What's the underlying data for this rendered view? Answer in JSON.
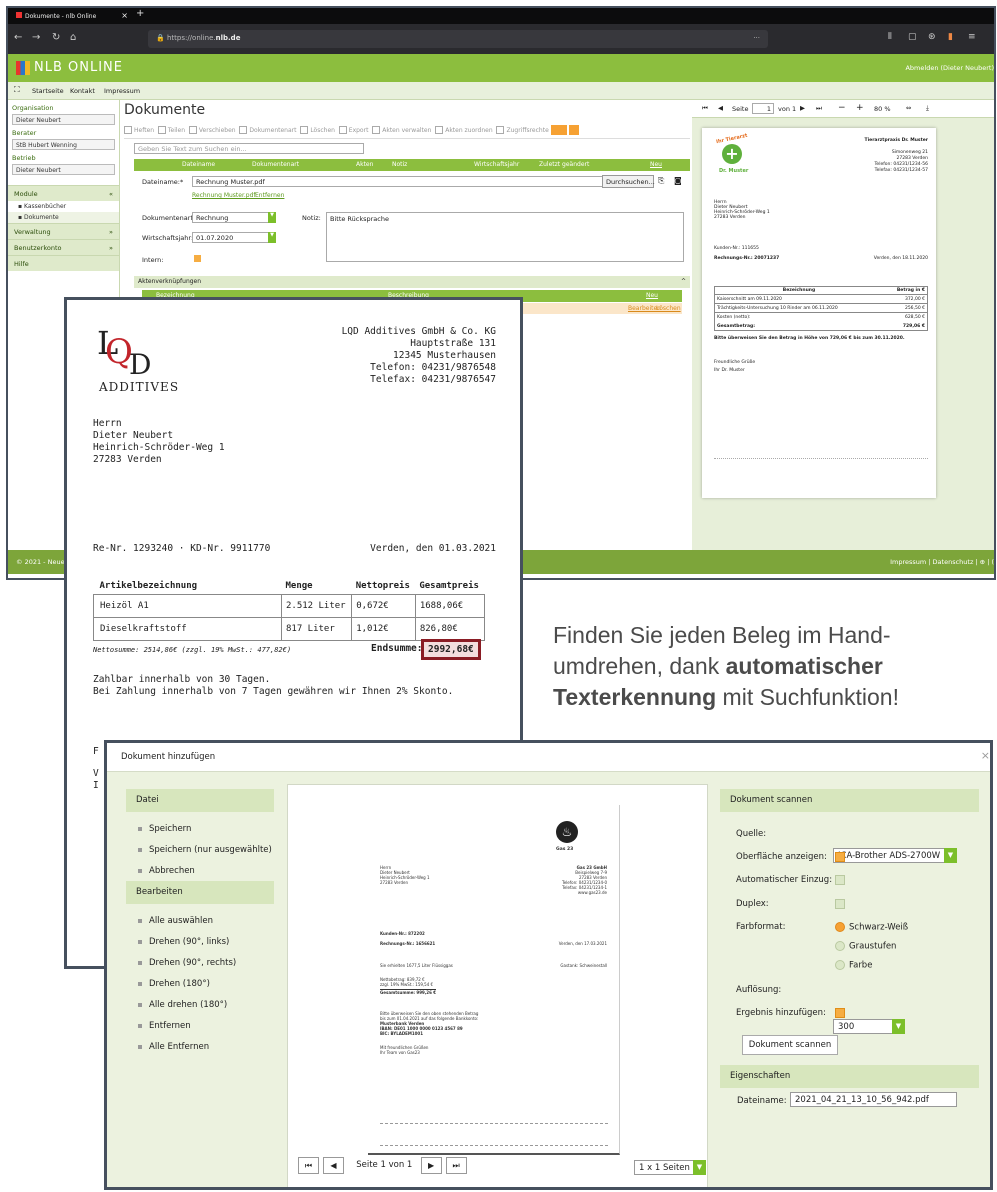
{
  "browser": {
    "tab_title": "Dokumente - nlb Online",
    "url_prefix": "https://online.",
    "url_domain": "nlb.de",
    "new_tab": "+",
    "close": "×",
    "menu": "···"
  },
  "app": {
    "logo_text": "NLB ONLINE",
    "logout": "Abmelden (Dieter Neubert)",
    "nav": [
      "Startseite",
      "Kontakt",
      "Impressum"
    ]
  },
  "sidebar": {
    "org_label": "Organisation",
    "org_value": "Dieter Neubert",
    "berater_label": "Berater",
    "berater_value": "StB Hubert Wenning",
    "betrieb_label": "Betrieb",
    "betrieb_value": "Dieter Neubert",
    "modules": "Module",
    "sub1": "Kassenbücher",
    "sub2": "Dokumente",
    "sec2": "Verwaltung",
    "sec3": "Benutzerkonto",
    "sec4": "Hilfe"
  },
  "main": {
    "title": "Dokumente",
    "toolbar": [
      "Heften",
      "Teilen",
      "Verschieben",
      "Dokumentenart",
      "Löschen",
      "Export",
      "Akten verwalten",
      "Akten zuordnen",
      "Zugriffsrechte"
    ],
    "search_placeholder": "Geben Sie Text zum Suchen ein...",
    "cols": [
      "Dateiname",
      "Dokumentenart",
      "Akten",
      "Notiz",
      "Wirtschaftsjahr",
      "Zuletzt geändert",
      "Neu"
    ],
    "dateiname_label": "Dateiname:*",
    "dateiname_value": "Rechnung Muster.pdf",
    "browse": "Durchsuchen...",
    "link1": "Rechnung Muster.pdf",
    "link2": "Entfernen",
    "doktyp_label": "Dokumentenart:*",
    "doktyp_value": "Rechnung",
    "notiz_label": "Notiz:",
    "notiz_value": "Bitte Rücksprache",
    "wj_label": "Wirtschaftsjahr:",
    "wj_value": "01.07.2020",
    "intern_label": "Intern:",
    "akten_header": "Aktenverknüpfungen",
    "akten_col1": "Bezeichnung",
    "akten_col2": "Beschreibung",
    "akten_new": "Neu",
    "akten_edit": "Bearbeiten",
    "akten_del": "Löschen"
  },
  "footer": {
    "left": "© 2021 - Neue La",
    "right": "Impressum | Datenschutz | ⊕ | ("
  },
  "preview": {
    "page_label": "Seite",
    "page_value": "1",
    "of": "von 1",
    "zoom": "80 %",
    "vet_logo_top": "Ihr Tierarzt",
    "vet_logo_bottom": "Dr. Muster",
    "sender": [
      "Tierarztpraxis Dr. Muster",
      "Simonenweg 21",
      "27283 Verden",
      "Telefon: 04231/1234-56",
      "Telefax: 04231/1234-57"
    ],
    "recipient": [
      "Herrn",
      "Dieter Neubert",
      "Heinrich-Schröder-Weg 1",
      "27283 Verden"
    ],
    "kunden": "Kunden-Nr.: 111655",
    "rnr": "Rechnungs-Nr.: 20071237",
    "datum": "Verden, den 18.11.2020",
    "th1": "Bezeichnung",
    "th2": "Betrag in €",
    "rows": [
      [
        "Kaiserschnitt am 09.11.2020",
        "372,00 €"
      ],
      [
        "Trächtigkeits-Untersuchung 10 Rinder am 06.11.2020",
        "256,50 €"
      ],
      [
        "Kosten (netto):",
        "628,50 €"
      ],
      [
        "Gesamtbetrag:",
        "729,06 €"
      ]
    ],
    "hint": "Bitte überweisen Sie den Betrag in Höhe von 729,06 € bis zum 30.11.2020.",
    "greet1": "Freundliche Grüße",
    "greet2": "Ihr Dr. Muster"
  },
  "invoice": {
    "logo_l": "L",
    "logo_q": "Q",
    "logo_d": "D",
    "logo_word": "ADDITIVES",
    "company": [
      "LQD Additives GmbH & Co. KG",
      "Hauptstraße 131",
      "12345 Musterhausen",
      "Telefon: 04231/9876548",
      "Telefax: 04231/9876547"
    ],
    "recipient": [
      "Herrn",
      "Dieter Neubert",
      "Heinrich-Schröder-Weg 1",
      "27283 Verden"
    ],
    "ref": "Re-Nr. 1293240 · KD-Nr. 9911770",
    "date": "Verden, den 01.03.2021",
    "headers": [
      "Artikelbezeichnung",
      "Menge",
      "Nettopreis",
      "Gesamtpreis"
    ],
    "rows": [
      [
        "Heizöl A1",
        "2.512 Liter",
        "0,672€",
        "1688,06€"
      ],
      [
        "Dieselkraftstoff",
        "817 Liter",
        "1,012€",
        "826,80€"
      ]
    ],
    "netto": "Nettosumme: 2514,86€ (zzgl. 19% MwSt.: 477,82€)",
    "end_label": "Endsumme:",
    "end_value": "2992,68€",
    "pay1": "Zahlbar innerhalb von 30 Tagen.",
    "pay2": "Bei Zahlung innerhalb von 7 Tagen gewähren wir Ihnen 2% Skonto.",
    "frag1": "F",
    "frag2": "V",
    "frag3": "I"
  },
  "promo": {
    "l1": "Finden Sie jeden Beleg im Hand-",
    "l2a": "umdrehen, dank ",
    "l2b": "automatischer",
    "l3a": "Texterkennung",
    "l3b": " mit Suchfunktion!"
  },
  "dialog": {
    "title": "Dokument hinzufügen",
    "close": "×",
    "datei": "Datei",
    "datei_items": [
      "Speichern",
      "Speichern (nur ausgewählte)",
      "Abbrechen"
    ],
    "bearbeiten": "Bearbeiten",
    "bearbeiten_items": [
      "Alle auswählen",
      "Drehen (90°, links)",
      "Drehen (90°, rechts)",
      "Drehen (180°)",
      "Alle drehen (180°)",
      "Entfernen",
      "Alle Entfernen"
    ],
    "scan_head": "Dokument scannen",
    "quelle_label": "Quelle:",
    "quelle_value": "ICA-Brother ADS-2700W",
    "oberflaeche": "Oberfläche anzeigen:",
    "auto": "Automatischer Einzug:",
    "duplex": "Duplex:",
    "farbformat": "Farbformat:",
    "ff": [
      "Schwarz-Weiß",
      "Graustufen",
      "Farbe"
    ],
    "aufl_label": "Auflösung:",
    "aufl_value": "300",
    "ergebnis": "Ergebnis hinzufügen:",
    "scan_btn": "Dokument scannen",
    "eig_head": "Eigenschaften",
    "dn_label": "Dateiname:",
    "dn_value": "2021_04_21_13_10_56_942.pdf",
    "page_text": "Seite 1 von 1",
    "layout": "1 x 1 Seiten"
  },
  "gasdoc": {
    "brand": "Gas 23",
    "recipient": [
      "Herrn",
      "Dieter Neubert",
      "Heinrich-Schröder-Weg 1",
      "27283 Verden"
    ],
    "sender": [
      "Gas 23 GmbH",
      "Beispielweg 7-9",
      "27283 Verden",
      "Telefon: 04231/1234-0",
      "Telefax: 04231/1234-1",
      "www.gas23.de"
    ],
    "kunden": "Kunden-Nr.: 872202",
    "rnr": "Rechnungs-Nr.: 1656621",
    "date": "Verden, den 17.03.2021",
    "line1": "Sie erhielten 1677,5 Liter Flüssiggas",
    "line1b": "Gastank: Schweinestall",
    "netto": "Nettobetrag: 839,72 €",
    "mwst": "zzgl. 19% MwSt.: 159,54 €",
    "gesamt": "Gesamtsumme: 999,26 €",
    "bank1": "Bitte überweisen Sie den oben stehenden Betrag",
    "bank2": "bis zum 01.04.2021 auf das folgende Bankkonto:",
    "bank3": "Musterbank Verden",
    "bank4": "IBAN: DE01 1000 0000 0123 4567 89",
    "bank5": "BIC: BYLADEM1001",
    "greet1": "Mit freundlichen Grüßen",
    "greet2": "Ihr Team von Gas23"
  }
}
